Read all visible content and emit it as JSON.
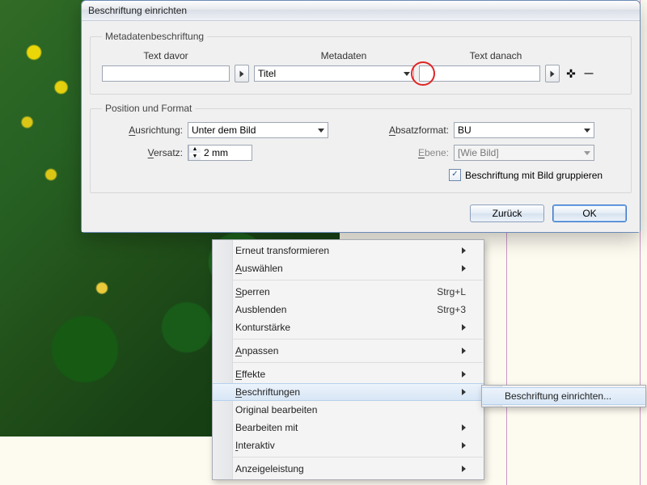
{
  "dialog": {
    "title": "Beschriftung einrichten",
    "meta_group": "Metadatenbeschriftung",
    "text_before_label": "Text davor",
    "metadata_label": "Metadaten",
    "text_after_label": "Text danach",
    "text_before_value": "",
    "metadata_value": "Titel",
    "text_after_value": "",
    "pos_group": "Position und Format",
    "align_label_pre": "A",
    "align_label_rest": "usrichtung:",
    "align_value": "Unter dem Bild",
    "offset_label_pre": "V",
    "offset_label_rest": "ersatz:",
    "offset_value": "2 mm",
    "paraformat_label_pre": "A",
    "paraformat_label_rest": "bsatzformat:",
    "paraformat_value": "BU",
    "layer_label_pre": "E",
    "layer_label_rest": "bene:",
    "layer_value": "[Wie Bild]",
    "group_checkbox": "Beschriftung mit Bild gruppieren",
    "group_checked": true,
    "btn_back": "Zurück",
    "btn_ok": "OK"
  },
  "menu": {
    "items": [
      {
        "label": "Erneut transformieren",
        "submenu": true
      },
      {
        "label_u": "A",
        "label_rest": "uswählen",
        "submenu": true
      },
      {
        "sep": true
      },
      {
        "label_u": "S",
        "label_rest": "perren",
        "shortcut": "Strg+L"
      },
      {
        "label": "Ausblenden",
        "shortcut": "Strg+3"
      },
      {
        "label": "Konturstärke",
        "submenu": true
      },
      {
        "sep": true
      },
      {
        "label_u": "A",
        "label_rest": "npassen",
        "submenu": true
      },
      {
        "sep": true
      },
      {
        "label_u": "E",
        "label_rest": "ffekte",
        "submenu": true
      },
      {
        "label_u": "B",
        "label_rest": "eschriftungen",
        "submenu": true,
        "highlight": true
      },
      {
        "label": "Original bearbeiten"
      },
      {
        "label": "Bearbeiten mit",
        "submenu": true
      },
      {
        "label_u": "I",
        "label_rest": "nteraktiv",
        "submenu": true
      },
      {
        "sep": true
      },
      {
        "label": "Anzeigeleistung",
        "submenu": true
      }
    ],
    "submenu_label": "Beschriftung einrichten..."
  }
}
